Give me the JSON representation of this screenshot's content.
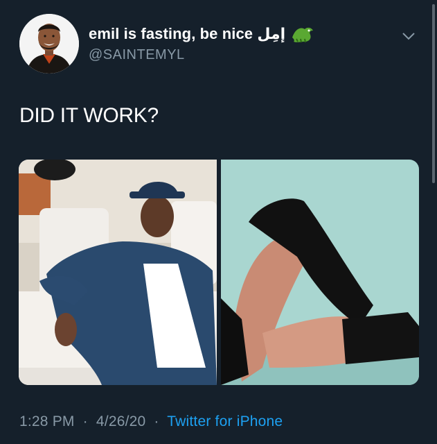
{
  "tweet": {
    "display_name": "emil is fasting, be nice إمِل",
    "handle": "@SAINTEMYL",
    "text": "DID IT WORK?",
    "time": "1:28 PM",
    "date": "4/26/20",
    "source": "Twitter for iPhone",
    "separator": "·"
  },
  "icons": {
    "emoji": "crocodile-icon",
    "menu": "chevron-down-icon"
  },
  "colors": {
    "background": "#15202b",
    "secondary_text": "#8899a6",
    "link": "#1da1f2"
  }
}
